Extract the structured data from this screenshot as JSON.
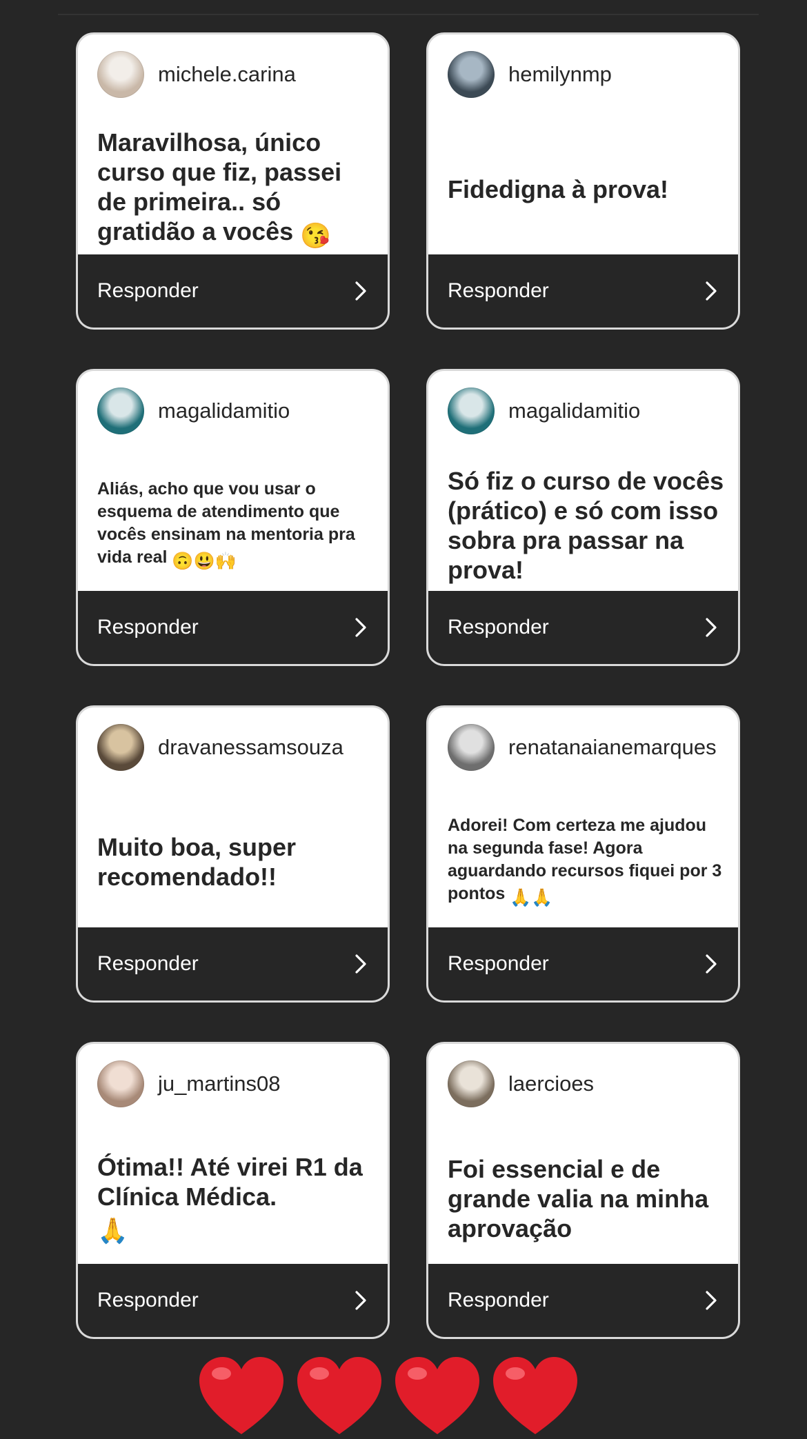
{
  "reply_label": "Responder",
  "cards": [
    {
      "username": "michele.carina",
      "message": "Maravilhosa, único curso que fiz, passei de primeira.. só gratidão a vocês",
      "emoji": "😘",
      "size": "large",
      "avatar_color": "#c9b8a8",
      "avatar_accent": "#f2eee9"
    },
    {
      "username": "hemilynmp",
      "message": "Fidedigna à prova!",
      "emoji": "",
      "size": "large",
      "avatar_color": "#3c4a55",
      "avatar_accent": "#a7b7c4"
    },
    {
      "username": "magalidamitio",
      "message": "Aliás, acho que vou usar o esquema de atendimento que vocês ensinam na mentoria pra vida real",
      "emoji": "🙃😃🙌",
      "size": "small",
      "avatar_color": "#1f6f78",
      "avatar_accent": "#d9e6e8"
    },
    {
      "username": "magalidamitio",
      "message": "Só fiz o curso de vocês (prático) e só com isso sobra pra passar na prova!",
      "emoji": "",
      "size": "large",
      "avatar_color": "#1f6f78",
      "avatar_accent": "#d9e6e8"
    },
    {
      "username": "dravanessamsouza",
      "message": "Muito boa, super recomendado!!",
      "emoji": "",
      "size": "large",
      "avatar_color": "#5a4a3a",
      "avatar_accent": "#d8c3a0"
    },
    {
      "username": "renatanaianemarques",
      "message": "Adorei! Com certeza me ajudou na segunda fase! Agora aguardando recursos fiquei por 3 pontos",
      "emoji": "🙏🙏",
      "size": "small",
      "avatar_color": "#6e6e6e",
      "avatar_accent": "#e0e0e0"
    },
    {
      "username": "ju_martins08",
      "message": "Ótima!! Até virei R1 da Clínica Médica.",
      "emoji": "🙏",
      "size": "large",
      "avatar_color": "#a88a78",
      "avatar_accent": "#f0ded3"
    },
    {
      "username": "laercioes",
      "message": "Foi essencial e de grande valia na minha aprovação",
      "emoji": "",
      "size": "large",
      "avatar_color": "#7c6e5e",
      "avatar_accent": "#e9e2d8"
    }
  ],
  "hearts_count": 4,
  "colors": {
    "background": "#262626",
    "card": "#ffffff",
    "heart": "#e11d2a"
  }
}
